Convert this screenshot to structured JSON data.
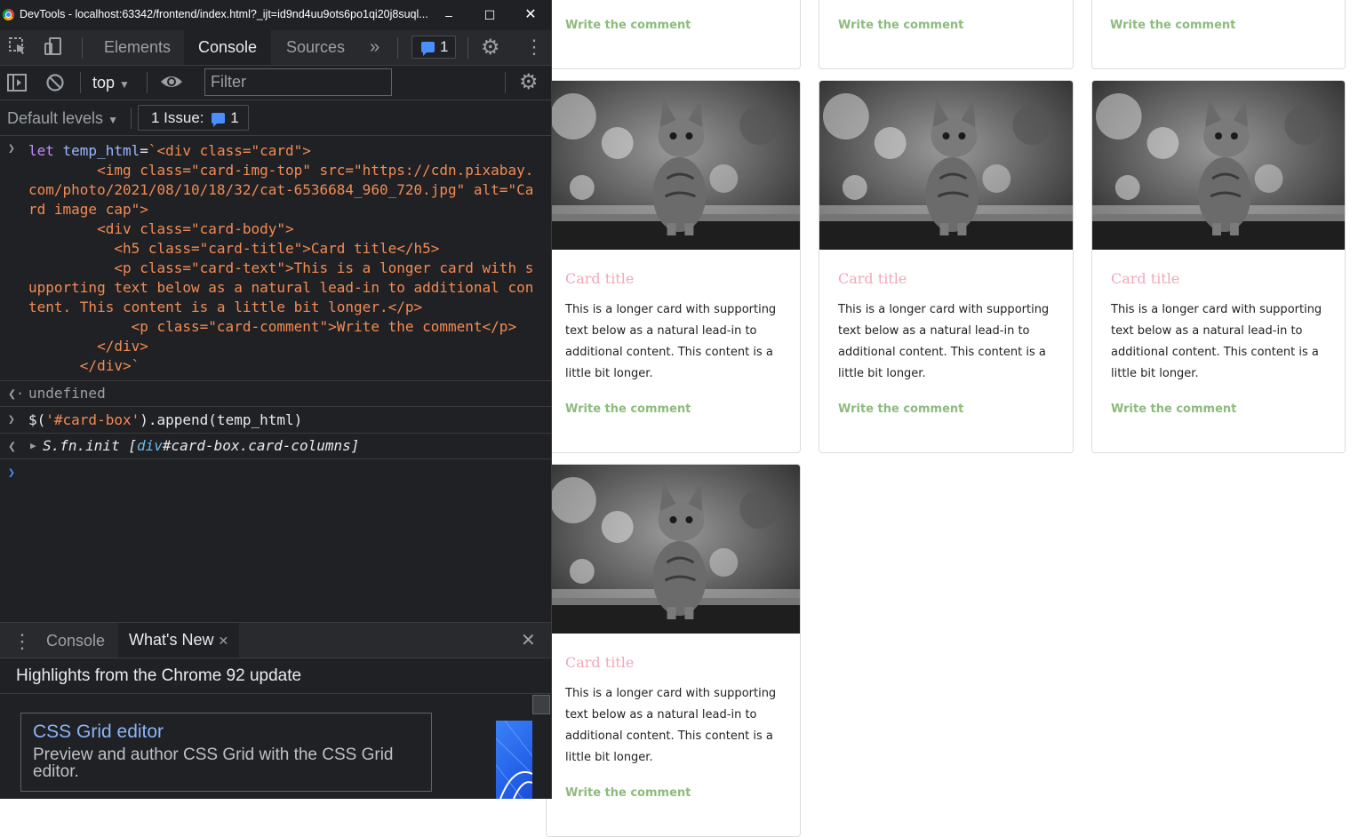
{
  "window": {
    "title": "DevTools - localhost:63342/frontend/index.html?_ijt=id9nd4uu9ots6po1qi20j8suql..."
  },
  "tabs": {
    "elements": "Elements",
    "console": "Console",
    "sources": "Sources",
    "more": "»",
    "messages_count": "1"
  },
  "toolbar": {
    "context": "top",
    "filter_placeholder": "Filter",
    "levels": "Default levels",
    "issues_label": "1 Issue:",
    "issues_count": "1"
  },
  "console": {
    "entry1_code": [
      {
        "t": "let ",
        "c": "kw"
      },
      {
        "t": "temp_html",
        "c": "vr"
      },
      {
        "t": "=",
        "c": ""
      },
      {
        "t": "`<div class=\"card\">\n        <img class=\"card-img-top\" src=\"https://cdn.pixabay.com/photo/2021/08/10/18/32/cat-6536684_960_720.jpg\" alt=\"Card image cap\">\n        <div class=\"card-body\">\n          <h5 class=\"card-title\">Card title</h5>\n          <p class=\"card-text\">This is a longer card with supporting text below as a natural lead-in to additional content. This content is a little bit longer.</p>\n            <p class=\"card-comment\">Write the comment</p>\n        </div>\n      </div>`",
        "c": "str"
      }
    ],
    "entry1_result": "undefined",
    "entry2_code_prefix": "$(",
    "entry2_code_str": "'#card-box'",
    "entry2_code_suffix": ").append(temp_html)",
    "entry2_result_prefix": "S.fn.init [",
    "entry2_result_tag": "div",
    "entry2_result_id": "#card-box.card-columns",
    "entry2_result_suffix": "]"
  },
  "drawer": {
    "tab_console": "Console",
    "tab_whats_new": "What's New",
    "heading": "Highlights from the Chrome 92 update",
    "feature_title": "CSS Grid editor",
    "feature_desc": "Preview and author CSS Grid with the CSS Grid editor."
  },
  "cards": {
    "title": "Card title",
    "text": "This is a longer card with supporting text below as a natural lead-in to additional content. This content is a little bit longer.",
    "comment": "Write the comment"
  },
  "colors": {
    "title_pink": "#f4a7b9",
    "comment_green": "#8dbb7d",
    "devtools_bg": "#202124",
    "accent_blue": "#4b8eff"
  }
}
